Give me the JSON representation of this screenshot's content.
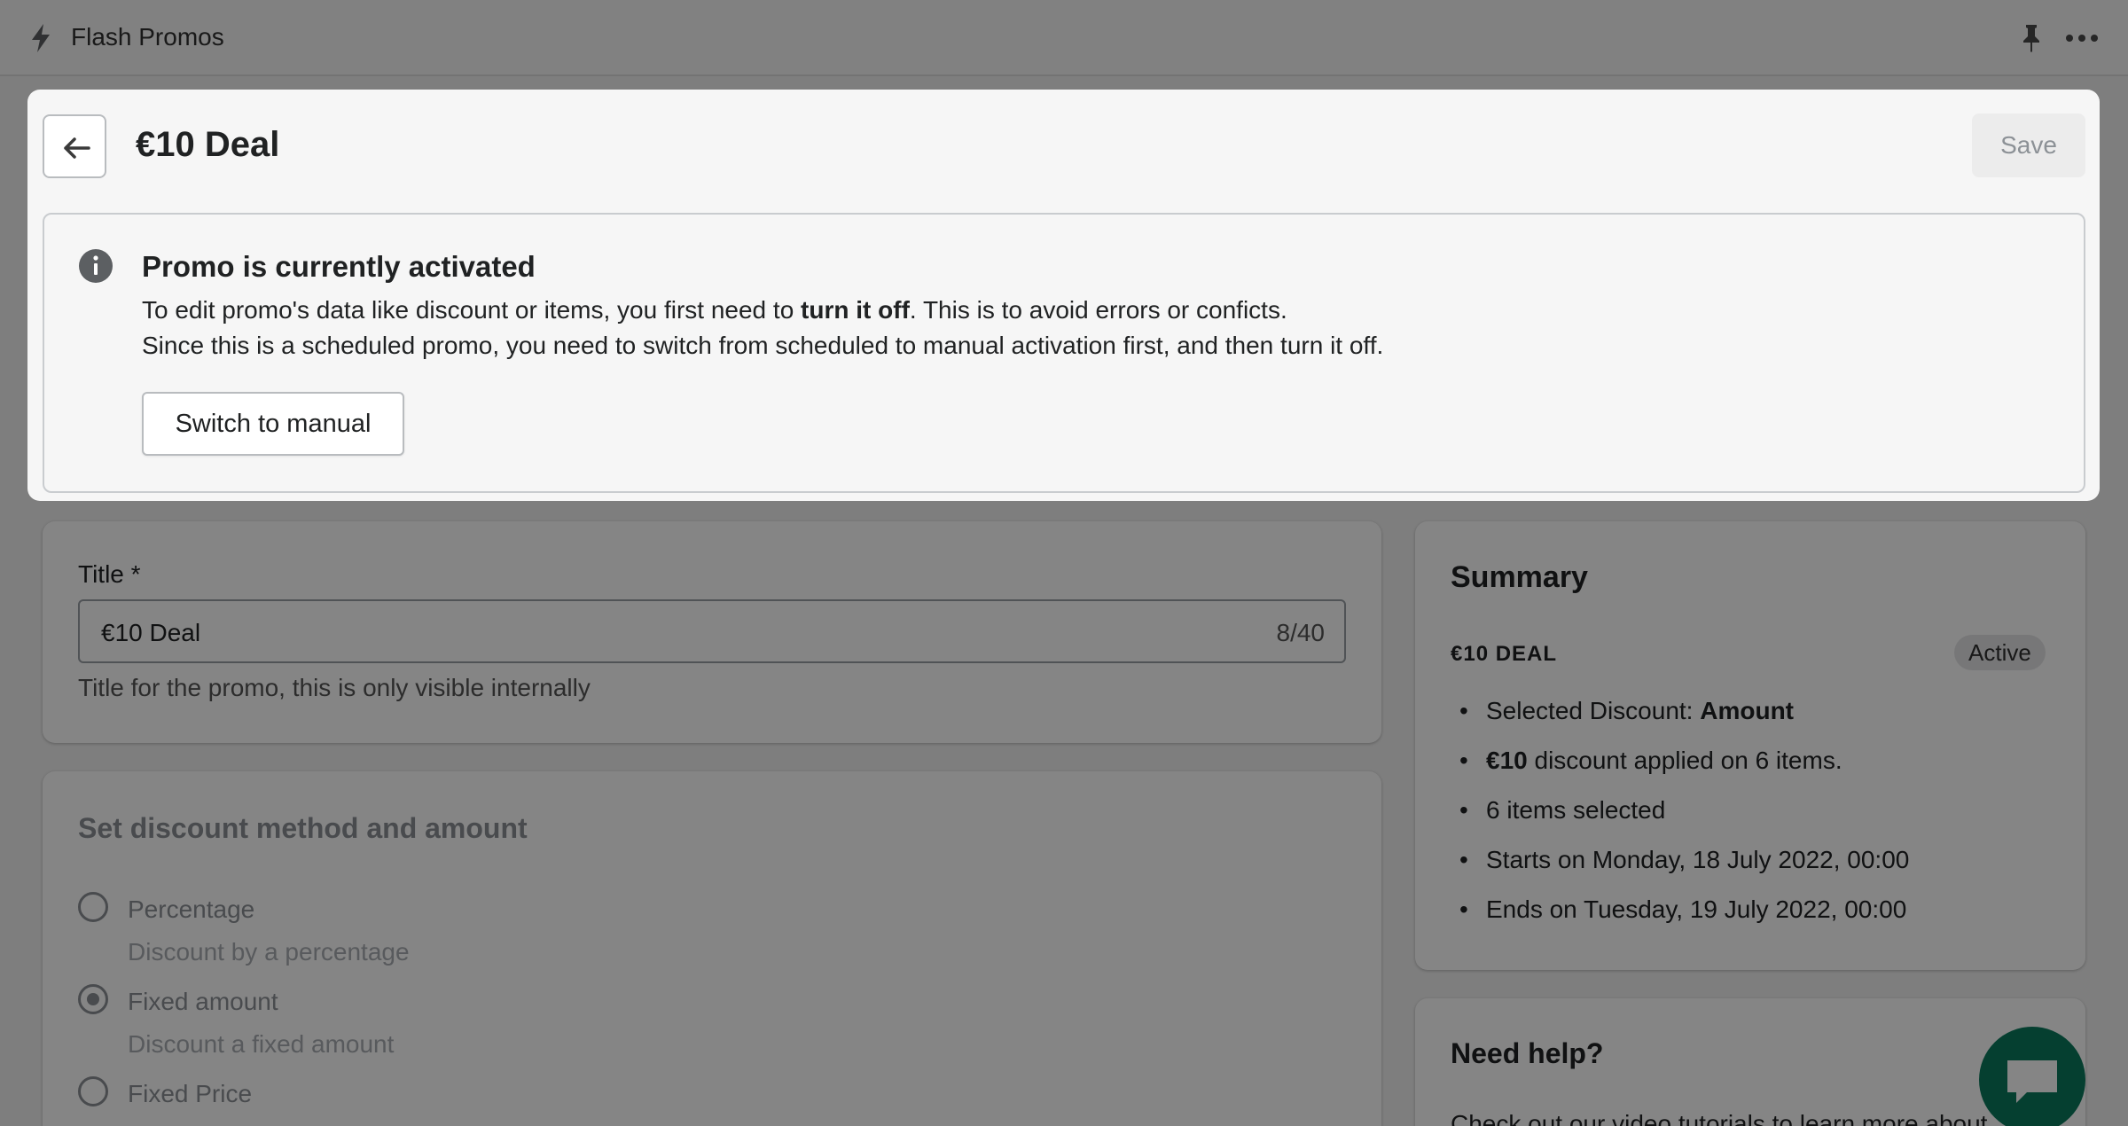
{
  "app": {
    "title": "Flash Promos",
    "icons": {
      "app": "lightning-bolt-icon",
      "pin": "pin-icon",
      "more": "more-horizontal-icon"
    }
  },
  "modal": {
    "title": "€10 Deal",
    "save_label": "Save",
    "banner": {
      "title": "Promo is currently activated",
      "line1_pre": "To edit promo's data like discount or items, you first need to ",
      "line1_bold": "turn it off",
      "line1_post": ". This is to avoid errors or conficts.",
      "line2": "Since this is a scheduled promo, you need to switch from scheduled to manual activation first, and then turn it off.",
      "button_label": "Switch to manual"
    }
  },
  "title_field": {
    "label": "Title *",
    "value": "€10 Deal",
    "counter": "8/40",
    "help_text": "Title for the promo, this is only visible internally"
  },
  "discount_method": {
    "heading": "Set discount method and amount",
    "options": [
      {
        "label": "Percentage",
        "description": "Discount by a percentage",
        "selected": false
      },
      {
        "label": "Fixed amount",
        "description": "Discount a fixed amount",
        "selected": true
      },
      {
        "label": "Fixed Price",
        "description": "",
        "selected": false
      }
    ]
  },
  "summary": {
    "heading": "Summary",
    "promo_name": "€10 DEAL",
    "status_badge": "Active",
    "items": [
      {
        "pre": "Selected Discount: ",
        "bold": "Amount",
        "post": ""
      },
      {
        "pre": "",
        "bold": "€10",
        "post": " discount applied on 6 items."
      },
      {
        "pre": "6 items selected",
        "bold": "",
        "post": ""
      },
      {
        "pre": "Starts on Monday, 18 July 2022, 00:00",
        "bold": "",
        "post": ""
      },
      {
        "pre": "Ends on Tuesday, 19 July 2022, 00:00",
        "bold": "",
        "post": ""
      }
    ]
  },
  "help": {
    "heading": "Need help?",
    "text": "Check out our video tutorials to learn more about"
  },
  "colors": {
    "overlay": "#000000",
    "chat_button": "#0b7a5c",
    "modal_background": "#f6f6f6"
  }
}
